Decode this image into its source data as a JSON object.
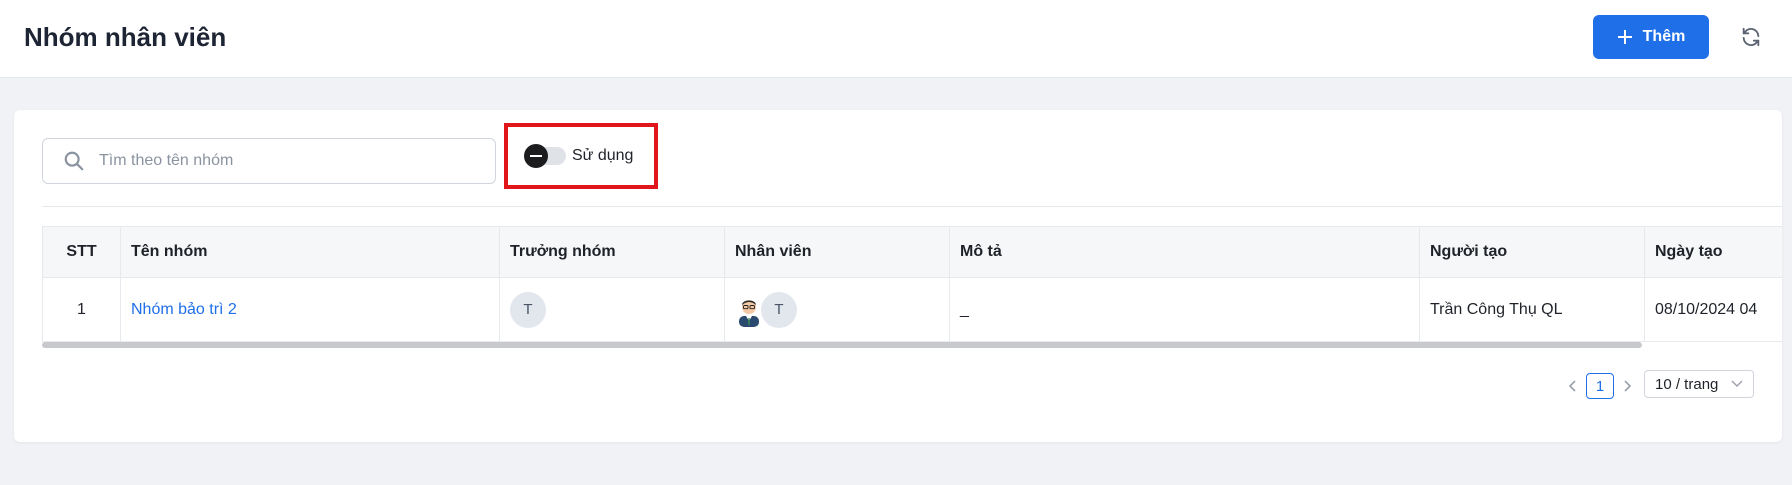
{
  "header": {
    "title": "Nhóm nhân viên",
    "add_label": "Thêm",
    "accent_color": "#1f6fe8"
  },
  "filters": {
    "search_placeholder": "Tìm theo tên nhóm",
    "toggle_label": "Sử dụng",
    "highlight_color": "#e0161b"
  },
  "table": {
    "columns": [
      "STT",
      "Tên nhóm",
      "Trưởng nhóm",
      "Nhân viên",
      "Mô tả",
      "Người tạo",
      "Ngày tạo"
    ],
    "rows": [
      {
        "stt": "1",
        "name": "Nhóm bảo trì 2",
        "leader_initial": "T",
        "member_initial": "T",
        "description": "_",
        "creator": "Trần Công Thụ QL",
        "created": "08/10/2024 04"
      }
    ]
  },
  "pagination": {
    "current_page": "1",
    "page_size": "10 / trang"
  },
  "icons": [
    "plus-icon",
    "refresh-icon",
    "search-icon",
    "chevron-left-icon",
    "chevron-right-icon",
    "chevron-down-icon"
  ]
}
